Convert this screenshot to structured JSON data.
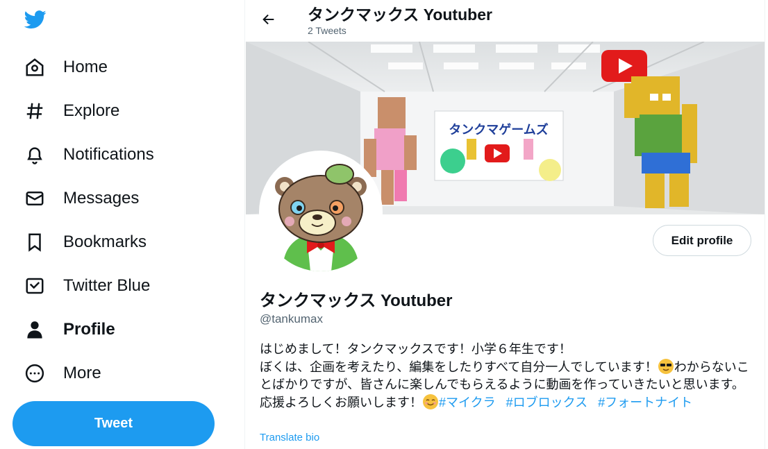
{
  "sidebar": {
    "logo_icon": "twitter-bird-icon",
    "items": [
      {
        "label": "Home",
        "icon": "home-icon"
      },
      {
        "label": "Explore",
        "icon": "hashtag-icon"
      },
      {
        "label": "Notifications",
        "icon": "bell-icon"
      },
      {
        "label": "Messages",
        "icon": "envelope-icon"
      },
      {
        "label": "Bookmarks",
        "icon": "bookmark-icon"
      },
      {
        "label": "Twitter Blue",
        "icon": "twitter-blue-icon"
      },
      {
        "label": "Profile",
        "icon": "person-icon",
        "active": true
      },
      {
        "label": "More",
        "icon": "more-circle-icon"
      }
    ],
    "tweet_label": "Tweet"
  },
  "header": {
    "title": "タンクマックス Youtuber",
    "subtitle": "2 Tweets"
  },
  "banner": {
    "sign_text": "タンクマゲームズ"
  },
  "profile": {
    "edit_label": "Edit profile",
    "display_name": "タンクマックス Youtuber",
    "handle": "@tankumax",
    "bio": {
      "line1": "はじめまして！タンクマックスです！小学６年生です！",
      "part1": "ぼくは、企画を考えたり、編集をしたりすべて自分一人でしています！",
      "part2": "わからないことばかりですが、皆さんに楽しんでもらえるように動画を作っていきたいと思います。応援よろしくお願いします！",
      "hashtags": [
        "#マイクラ",
        "#ロブロックス",
        "#フォートナイト"
      ]
    },
    "translate_label": "Translate bio"
  },
  "colors": {
    "accent": "#1d9bf0",
    "text": "#0f1419",
    "secondary": "#536471"
  }
}
